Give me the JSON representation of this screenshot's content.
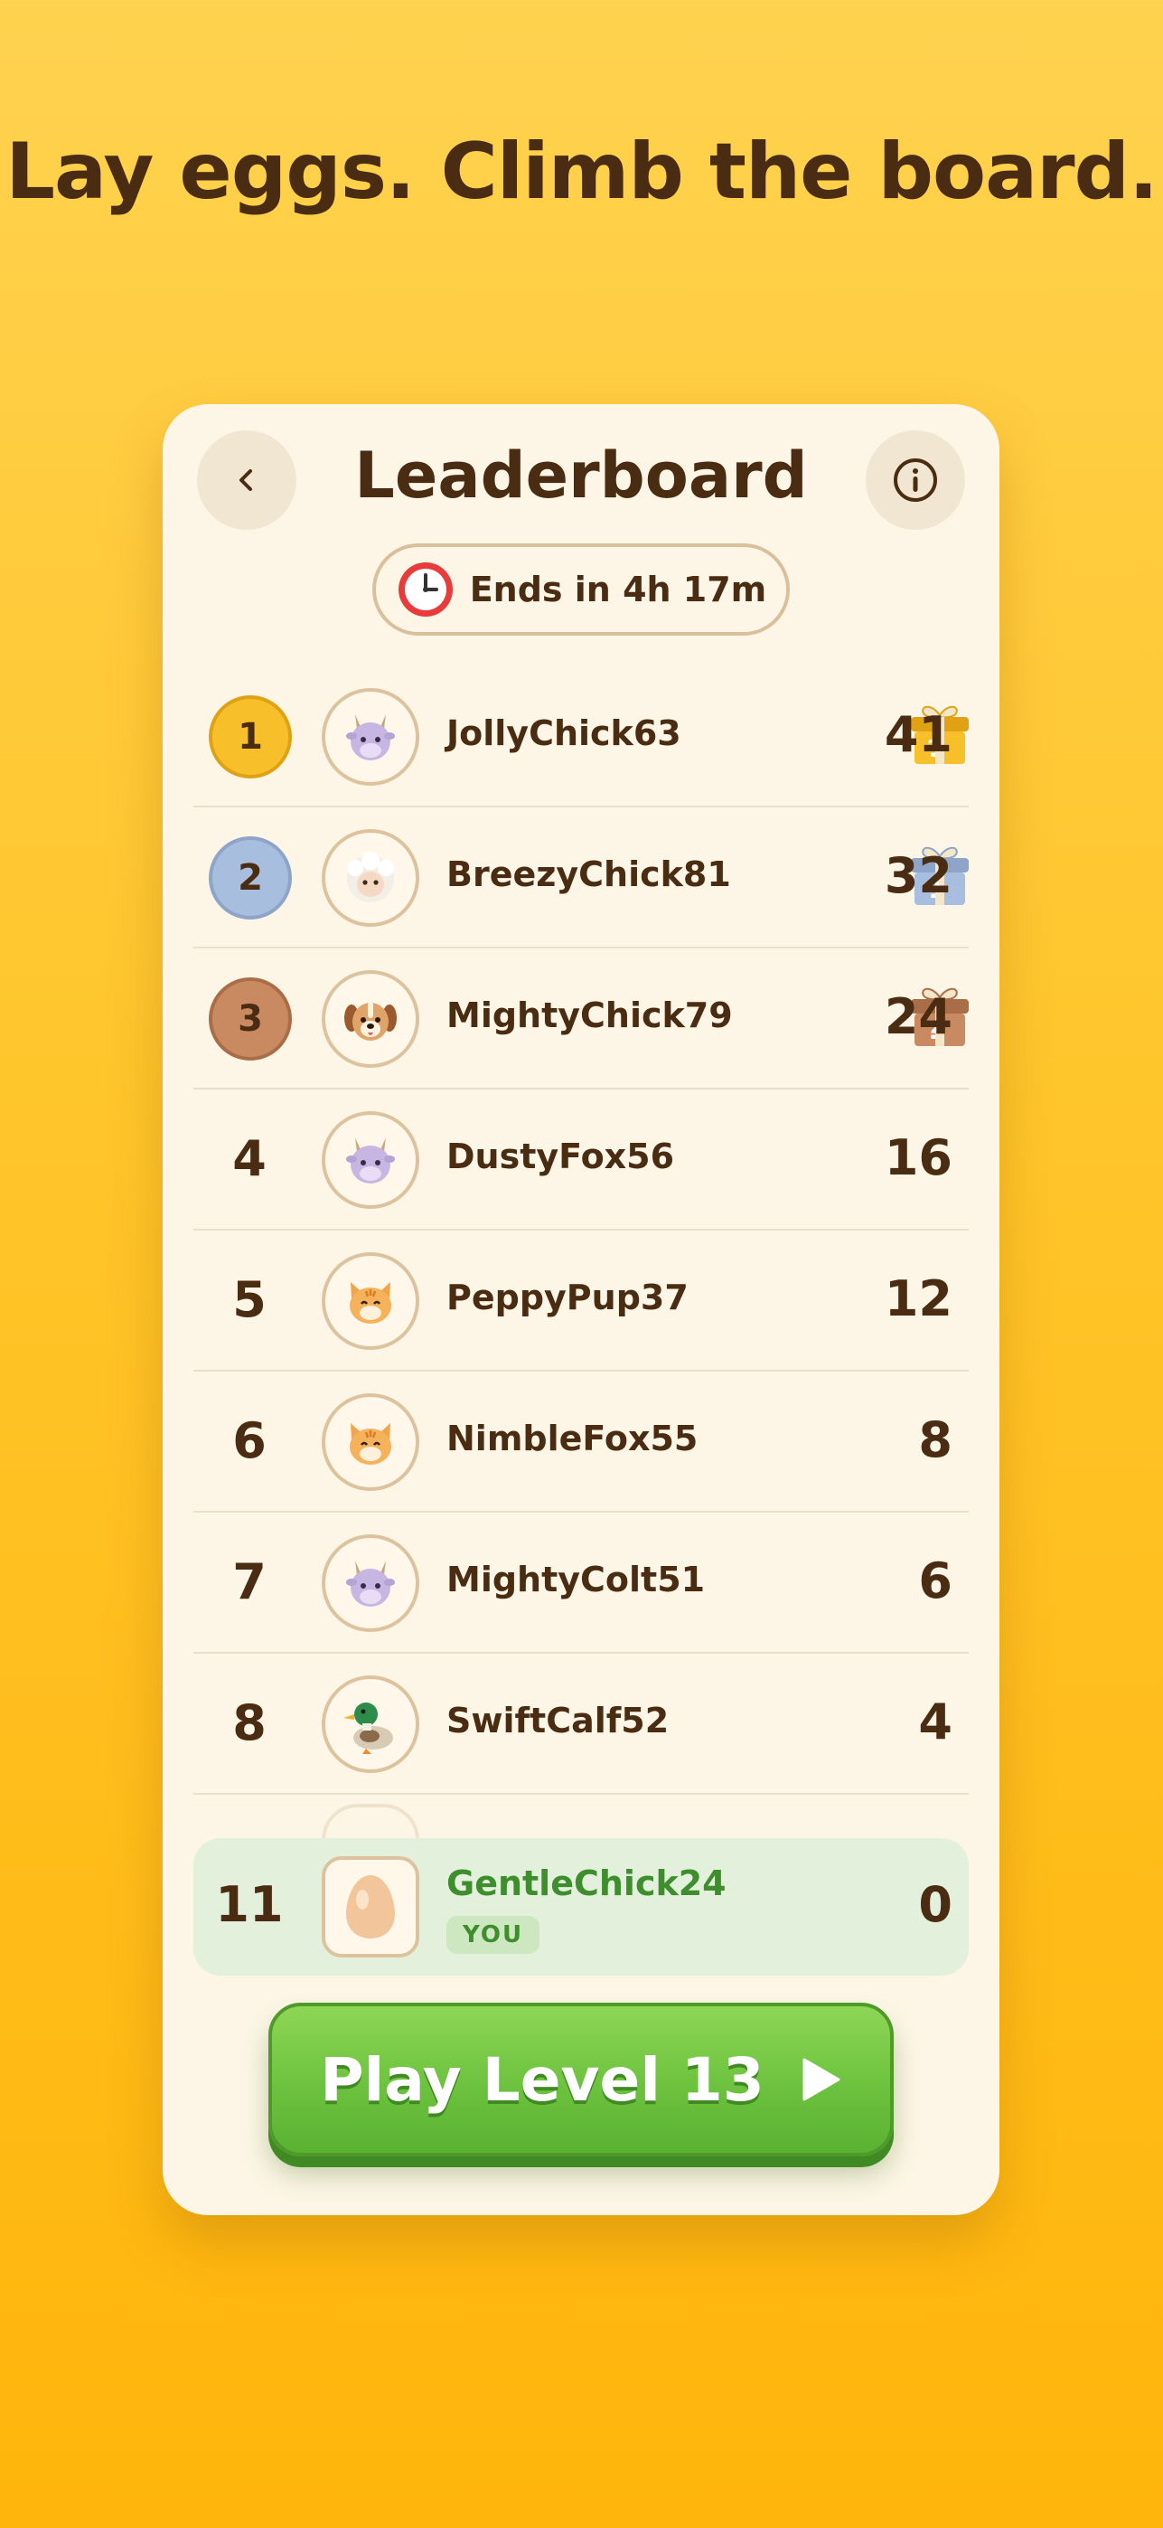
{
  "headline": "Lay eggs. Climb the board.",
  "leaderboard": {
    "title": "Leaderboard",
    "timer_text": "Ends in 4h 17m",
    "rows": [
      {
        "rank": "1",
        "name": "JollyChick63",
        "score": "41",
        "avatar": "goat-icon",
        "medal": "gold",
        "gift": "gold"
      },
      {
        "rank": "2",
        "name": "BreezyChick81",
        "score": "32",
        "avatar": "sheep-icon",
        "medal": "silver",
        "gift": "silver"
      },
      {
        "rank": "3",
        "name": "MightyChick79",
        "score": "24",
        "avatar": "dog-icon",
        "medal": "bronze",
        "gift": "bronze"
      },
      {
        "rank": "4",
        "name": "DustyFox56",
        "score": "16",
        "avatar": "goat-icon"
      },
      {
        "rank": "5",
        "name": "PeppyPup37",
        "score": "12",
        "avatar": "cat-icon"
      },
      {
        "rank": "6",
        "name": "NimbleFox55",
        "score": "8",
        "avatar": "cat-icon"
      },
      {
        "rank": "7",
        "name": "MightyColt51",
        "score": "6",
        "avatar": "goat-icon"
      },
      {
        "rank": "8",
        "name": "SwiftCalf52",
        "score": "4",
        "avatar": "duck-icon"
      }
    ],
    "you": {
      "rank": "11",
      "name": "GentleChick24",
      "badge": "YOU",
      "score": "0",
      "avatar": "egg-icon"
    },
    "play_button": "Play Level 13"
  },
  "colors": {
    "brown": "#4A2C12",
    "card": "#FDF6E6",
    "green": "#6CC23E",
    "gold": "#F7C02B",
    "silver": "#A8BEDF",
    "bronze": "#C98A62"
  }
}
